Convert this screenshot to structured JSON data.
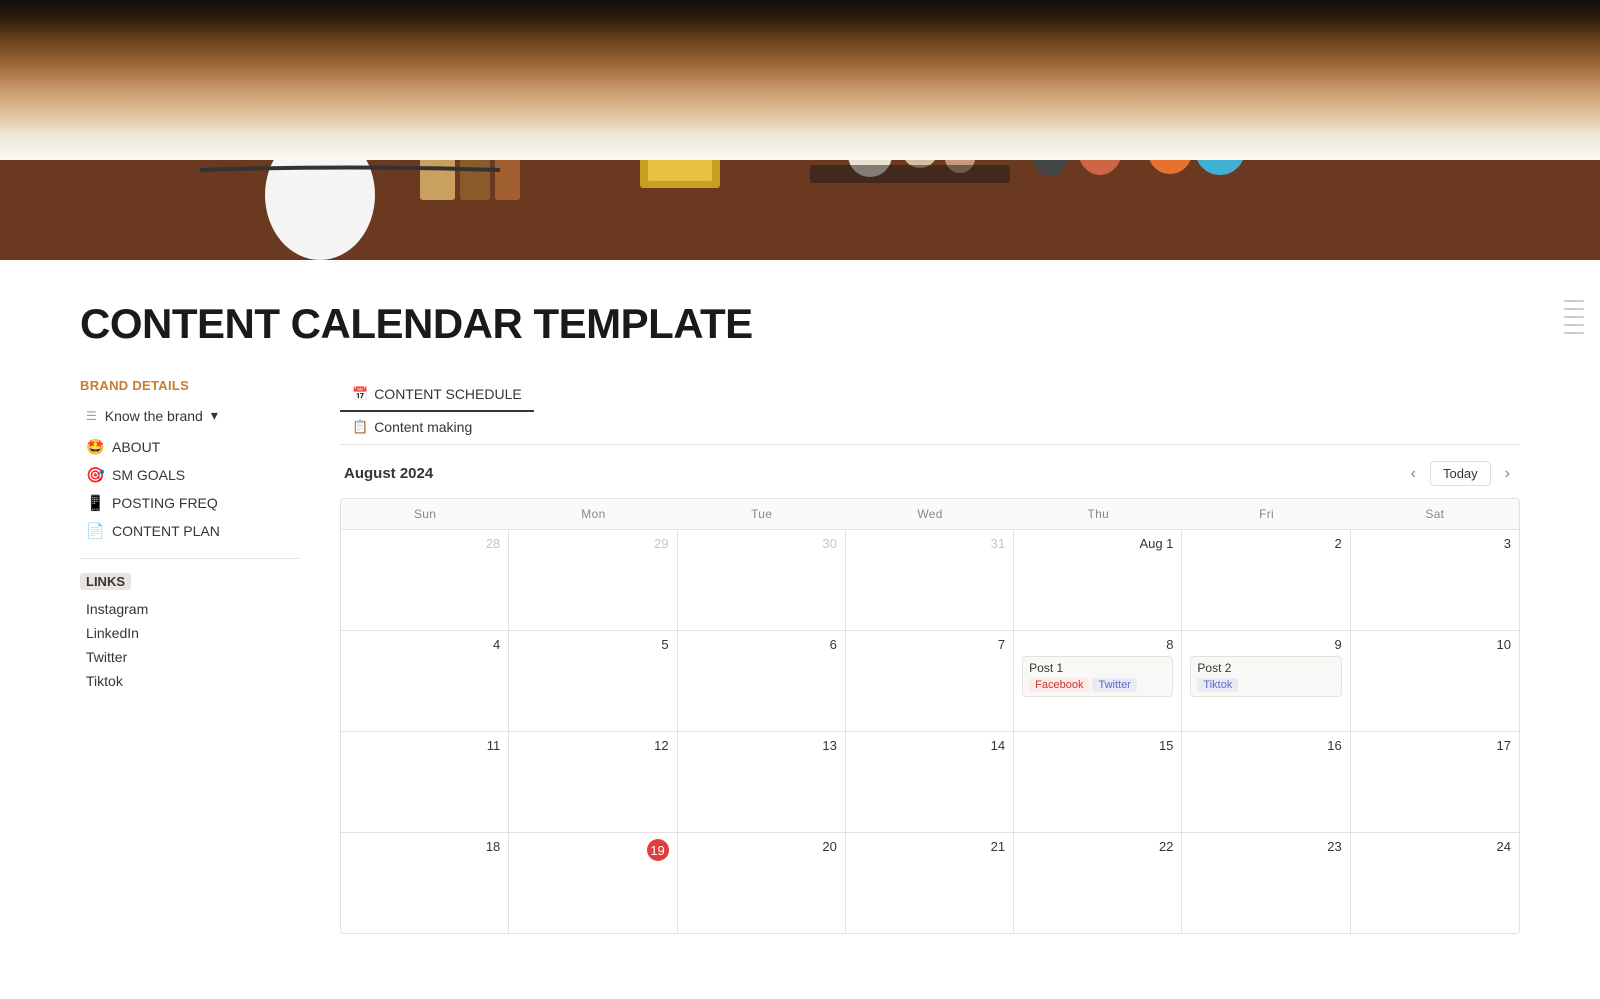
{
  "hero": {
    "alt": "Desk with items"
  },
  "page": {
    "title": "CONTENT CALENDAR TEMPLATE"
  },
  "sidebar": {
    "brand_section_title": "BRAND DETAILS",
    "know_brand_label": "Know the brand",
    "items": [
      {
        "id": "about",
        "icon": "🤩",
        "label": "ABOUT"
      },
      {
        "id": "sm-goals",
        "icon": "🎯",
        "label": "SM GOALS"
      },
      {
        "id": "posting-freq",
        "icon": "📱",
        "label": "POSTING FREQ"
      },
      {
        "id": "content-plan",
        "icon": "📄",
        "label": "CONTENT PLAN"
      }
    ],
    "links_section_title": "LINKS",
    "links": [
      {
        "id": "instagram",
        "label": "Instagram"
      },
      {
        "id": "linkedin",
        "label": "LinkedIn"
      },
      {
        "id": "twitter",
        "label": "Twitter"
      },
      {
        "id": "tiktok",
        "label": "Tiktok"
      }
    ]
  },
  "calendar": {
    "tabs": [
      {
        "id": "content-schedule",
        "icon": "📅",
        "label": "CONTENT SCHEDULE",
        "active": true
      },
      {
        "id": "content-making",
        "icon": "📋",
        "label": "Content making",
        "active": false
      }
    ],
    "month": "August 2024",
    "today_label": "Today",
    "day_names": [
      "Sun",
      "Mon",
      "Tue",
      "Wed",
      "Thu",
      "Fri",
      "Sat"
    ],
    "weeks": [
      {
        "days": [
          {
            "date": "28",
            "other_month": true,
            "events": []
          },
          {
            "date": "29",
            "other_month": true,
            "events": []
          },
          {
            "date": "30",
            "other_month": true,
            "events": []
          },
          {
            "date": "31",
            "other_month": true,
            "events": []
          },
          {
            "date": "Aug 1",
            "other_month": false,
            "highlight": false,
            "events": []
          },
          {
            "date": "2",
            "other_month": false,
            "events": []
          },
          {
            "date": "3",
            "other_month": false,
            "events": []
          }
        ]
      },
      {
        "days": [
          {
            "date": "4",
            "other_month": false,
            "events": []
          },
          {
            "date": "5",
            "other_month": false,
            "events": []
          },
          {
            "date": "6",
            "other_month": false,
            "events": []
          },
          {
            "date": "7",
            "other_month": false,
            "events": []
          },
          {
            "date": "8",
            "other_month": false,
            "events": [
              {
                "id": "post1",
                "title": "Post 1",
                "tags": [
                  {
                    "label": "Facebook",
                    "class": "tag-facebook"
                  },
                  {
                    "label": "Twitter",
                    "class": "tag-twitter"
                  }
                ]
              }
            ]
          },
          {
            "date": "9",
            "other_month": false,
            "events": [
              {
                "id": "post2",
                "title": "Post 2",
                "tags": [
                  {
                    "label": "Tiktok",
                    "class": "tag-tiktok"
                  }
                ]
              }
            ]
          },
          {
            "date": "10",
            "other_month": false,
            "events": []
          }
        ]
      },
      {
        "days": [
          {
            "date": "11",
            "other_month": false,
            "events": []
          },
          {
            "date": "12",
            "other_month": false,
            "events": []
          },
          {
            "date": "13",
            "other_month": false,
            "events": []
          },
          {
            "date": "14",
            "other_month": false,
            "events": []
          },
          {
            "date": "15",
            "other_month": false,
            "events": []
          },
          {
            "date": "16",
            "other_month": false,
            "events": []
          },
          {
            "date": "17",
            "other_month": false,
            "events": []
          }
        ]
      },
      {
        "days": [
          {
            "date": "18",
            "other_month": false,
            "events": []
          },
          {
            "date": "19",
            "other_month": false,
            "today": true,
            "events": []
          },
          {
            "date": "20",
            "other_month": false,
            "events": []
          },
          {
            "date": "21",
            "other_month": false,
            "events": []
          },
          {
            "date": "22",
            "other_month": false,
            "events": []
          },
          {
            "date": "23",
            "other_month": false,
            "events": []
          },
          {
            "date": "24",
            "other_month": false,
            "events": []
          }
        ]
      }
    ]
  }
}
